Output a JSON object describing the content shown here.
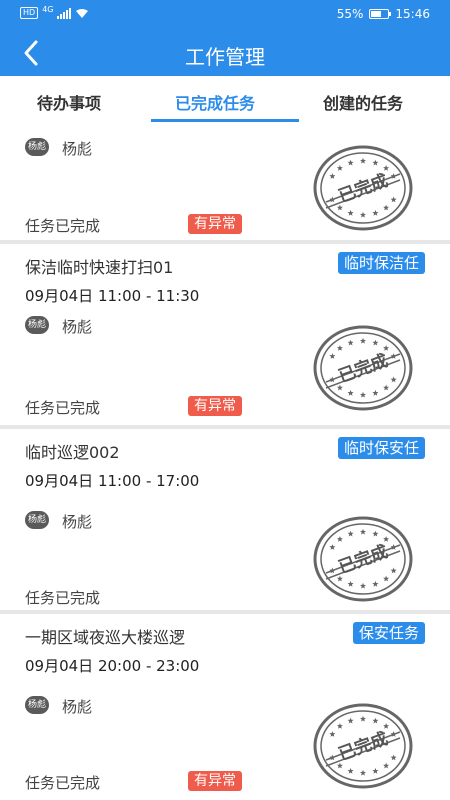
{
  "status_bar": {
    "hd": "HD",
    "network": "4G",
    "battery": "55%",
    "time": "15:46"
  },
  "header": {
    "title": "工作管理"
  },
  "tabs": [
    {
      "label": "待办事项"
    },
    {
      "label": "已完成任务"
    },
    {
      "label": "创建的任务"
    }
  ],
  "cards": [
    {
      "user": "杨彪",
      "avatar_text": "杨彪",
      "status": "任务已完成",
      "badge": "有异常",
      "stamp": "已完成"
    },
    {
      "title": "保洁临时快速打扫01",
      "type": "临时保洁任",
      "time": "09月04日 11:00 - 11:30",
      "user": "杨彪",
      "avatar_text": "杨彪",
      "status": "任务已完成",
      "badge": "有异常",
      "stamp": "已完成"
    },
    {
      "title": "临时巡逻002",
      "type": "临时保安任",
      "time": "09月04日 11:00 - 17:00",
      "user": "杨彪",
      "avatar_text": "杨彪",
      "status": "任务已完成",
      "stamp": "已完成"
    },
    {
      "title": "一期区域夜巡大楼巡逻",
      "type": "保安任务",
      "time": "09月04日 20:00 - 23:00",
      "user": "杨彪",
      "avatar_text": "杨彪",
      "status": "任务已完成",
      "badge": "有异常",
      "stamp": "已完成"
    }
  ]
}
